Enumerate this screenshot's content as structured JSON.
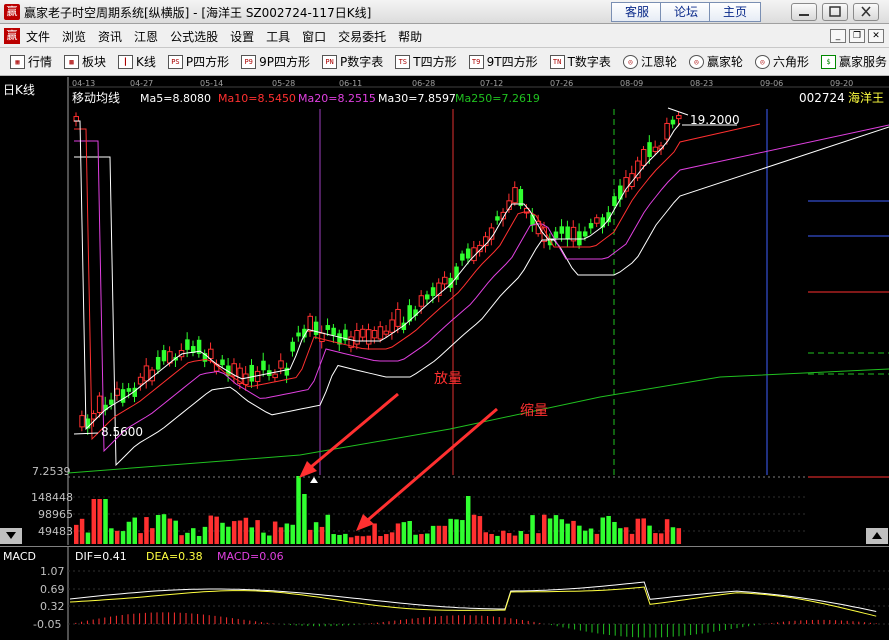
{
  "titlebar": {
    "icon": "赢",
    "title": "赢家老子时空周期系统[纵横版] - [海洋王   SZ002724-117日K线]",
    "buttons": [
      "客服",
      "论坛",
      "主页"
    ]
  },
  "menubar": {
    "icon": "赢",
    "items": [
      "文件",
      "浏览",
      "资讯",
      "江恩",
      "公式选股",
      "设置",
      "工具",
      "窗口",
      "交易委托",
      "帮助"
    ]
  },
  "toolbar": {
    "items": [
      {
        "icon": "grid-icon",
        "glyph": "▦",
        "label": "行情"
      },
      {
        "icon": "blocks-icon",
        "glyph": "▩",
        "label": "板块"
      },
      {
        "icon": "candle-icon",
        "glyph": "┃",
        "label": "K线"
      },
      {
        "icon": "ps-icon",
        "glyph": "PS",
        "label": "P四方形"
      },
      {
        "icon": "p9-icon",
        "glyph": "P9",
        "label": "9P四方形"
      },
      {
        "icon": "pn-icon",
        "glyph": "PN",
        "label": "P数字表"
      },
      {
        "icon": "ts-icon",
        "glyph": "TS",
        "label": "T四方形"
      },
      {
        "icon": "t9-icon",
        "glyph": "T9",
        "label": "9T四方形"
      },
      {
        "icon": "tn-icon",
        "glyph": "TN",
        "label": "T数字表"
      },
      {
        "icon": "gann-wheel-icon",
        "glyph": "◎",
        "label": "江恩轮"
      },
      {
        "icon": "winner-wheel-icon",
        "glyph": "◎",
        "label": "赢家轮"
      },
      {
        "icon": "hexagon-icon",
        "glyph": "◎",
        "label": "六角形"
      },
      {
        "icon": "dollar-icon",
        "glyph": "$",
        "label": "赢家服务"
      }
    ]
  },
  "chart": {
    "period_label": "日K线",
    "indicator_name": "移动均线",
    "ma": [
      {
        "label": "Ma5=8.8080",
        "color": "#ffffff"
      },
      {
        "label": "Ma10=8.5450",
        "color": "#ff3030"
      },
      {
        "label": "Ma20=8.2515",
        "color": "#e040e0"
      },
      {
        "label": "Ma30=7.8597",
        "color": "#ffffff"
      },
      {
        "label": "Ma250=7.2619",
        "color": "#20c020"
      }
    ],
    "stock_code": "002724",
    "stock_name": "海洋王",
    "dates": [
      "04-13",
      "04-27",
      "05-14",
      "05-28",
      "06-11",
      "06-28",
      "07-12",
      "07-26",
      "08-09",
      "08-23",
      "09-06",
      "09-20"
    ],
    "high_label": "19.2000",
    "low_label": "8.5600",
    "price_axis_bottom": "7.2539",
    "volume_ticks": [
      "148448",
      "98965",
      "49483"
    ],
    "annotation_expand": "放量",
    "annotation_shrink": "缩量",
    "colors": {
      "up": "#ff3030",
      "down": "#30ff30",
      "ma5": "#ffffff",
      "ma10": "#ff3030",
      "ma20": "#e040e0",
      "ma30": "#ffffff",
      "ma250": "#20c020"
    }
  },
  "macd": {
    "label": "MACD",
    "dif": "DIF=0.41",
    "dea": "DEA=0.38",
    "macd": "MACD=0.06",
    "ticks": [
      "1.07",
      "0.69",
      "0.32",
      "-0.05"
    ]
  }
}
